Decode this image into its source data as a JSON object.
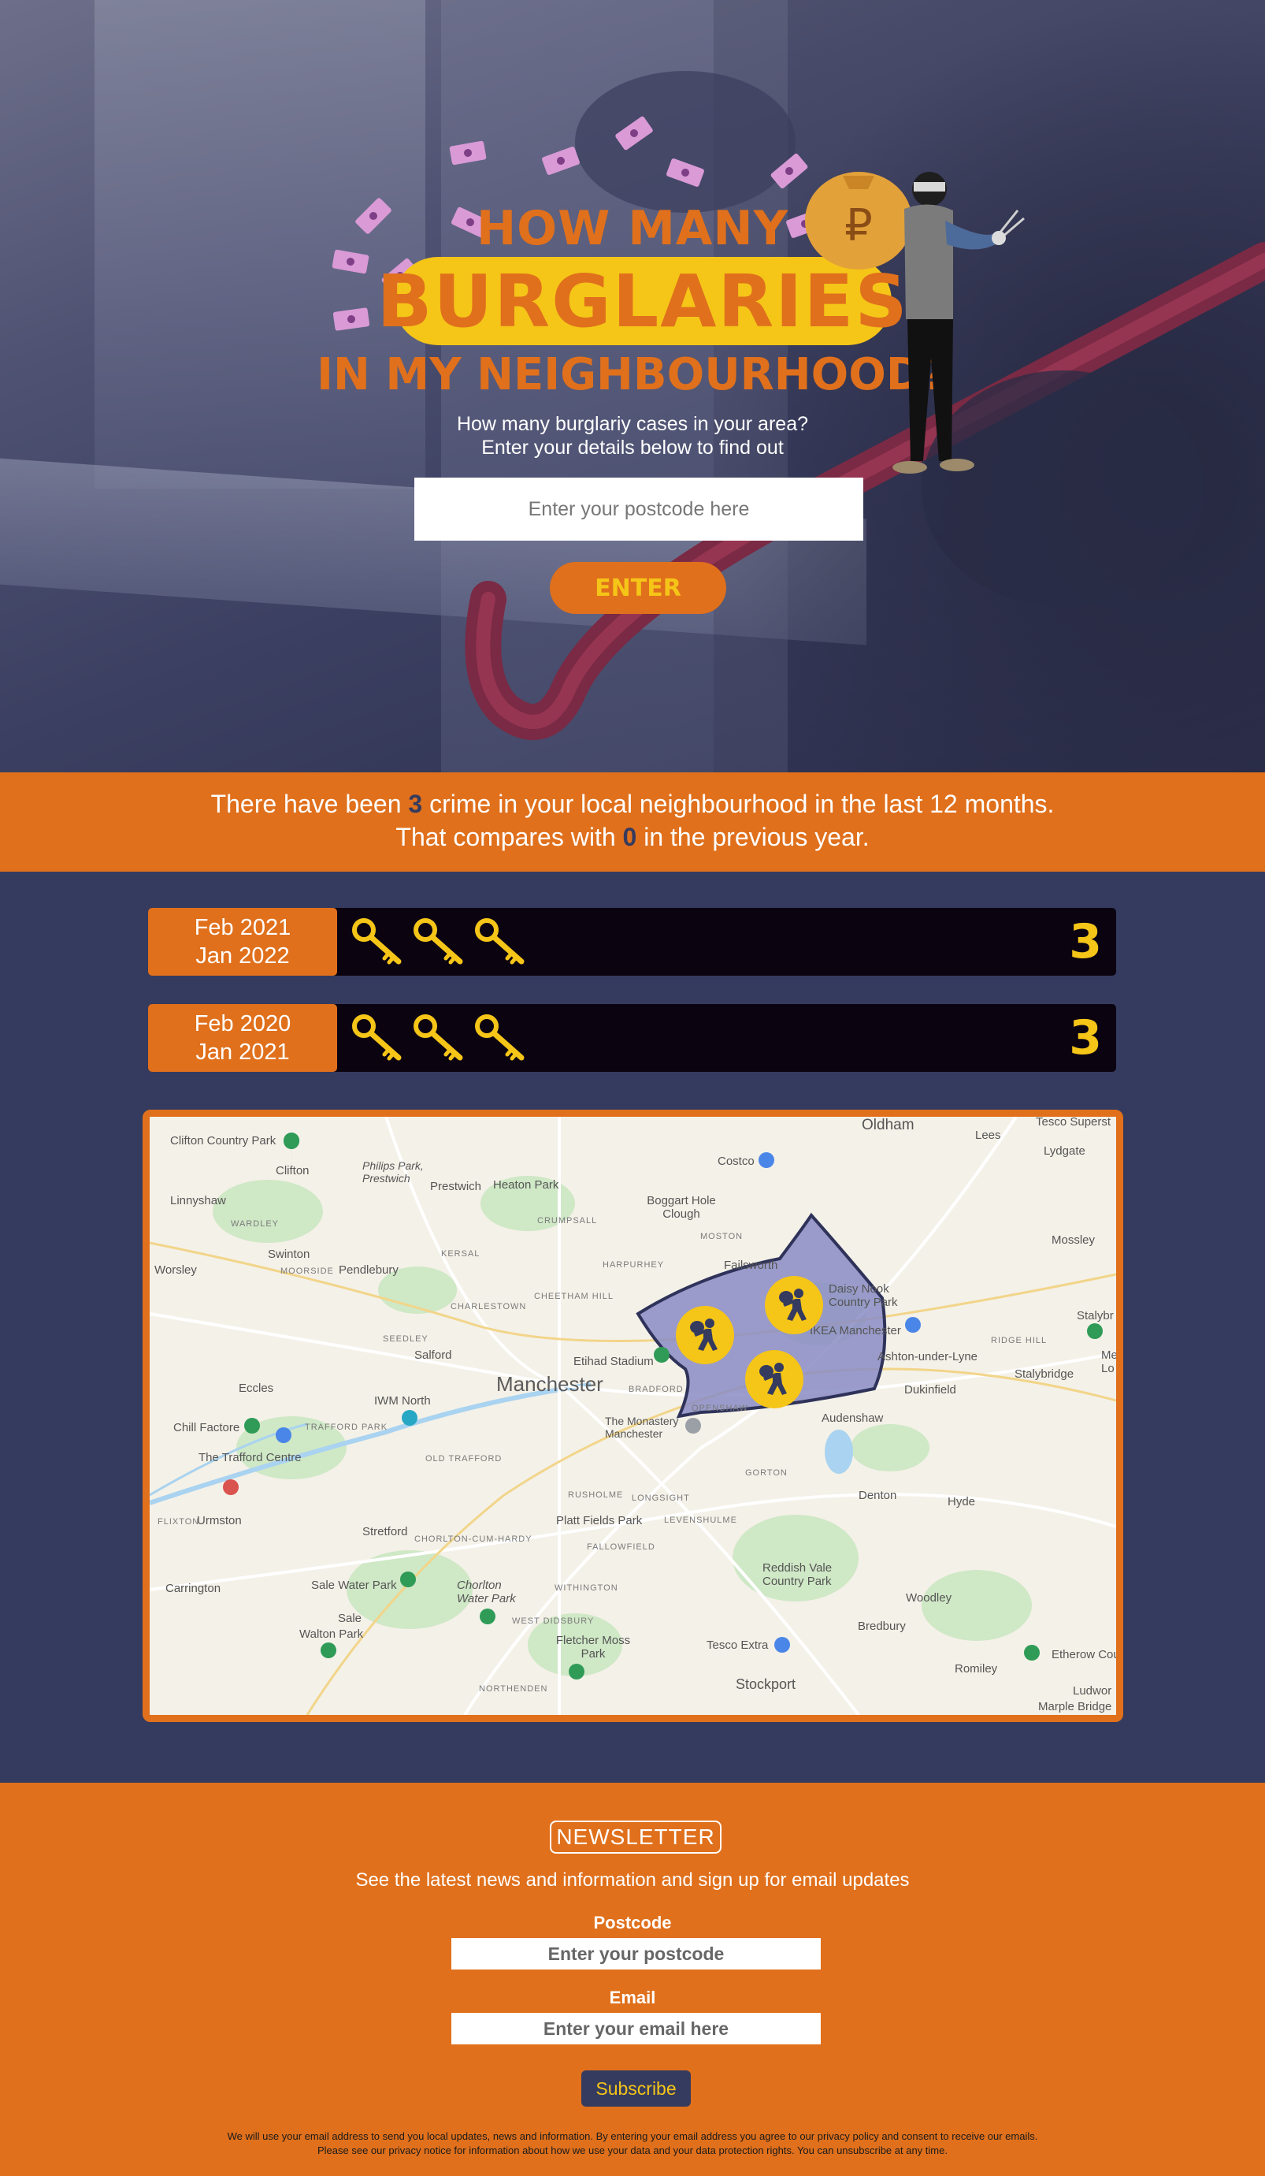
{
  "hero": {
    "title_top": "HOW MANY",
    "title_main": "BURGLARIES",
    "title_bottom": "IN MY NEIGHBOURHOOD?",
    "subtitle_line1": "How many burglariy cases in your area?",
    "subtitle_line2": "Enter your details below to find out",
    "postcode_placeholder": "Enter your postcode here",
    "enter_label": "ENTER"
  },
  "summary": {
    "line1_before": "There have been ",
    "line1_count": "3",
    "line1_after": " crime in your local neighbourhood in the last 12 months.",
    "line2_before": "That compares with ",
    "line2_count": "0",
    "line2_after": " in the previous year."
  },
  "periods": [
    {
      "from": "Feb 2021",
      "to": "Jan 2022",
      "keys": 3,
      "count": "3"
    },
    {
      "from": "Feb 2020",
      "to": "Jan 2021",
      "keys": 3,
      "count": "3"
    }
  ],
  "map": {
    "city": "Manchester",
    "labels": [
      "Oldham",
      "Tesco Superst",
      "Lees",
      "Lydgate",
      "Clifton Country Park",
      "Clifton",
      "Philips Park, Prestwich",
      "Prestwich",
      "Heaton Park",
      "Costco",
      "Linnyshaw",
      "Boggart Hole Clough",
      "WARDLEY",
      "CRUMPSALL",
      "MOSTON",
      "Mossley",
      "Swinton",
      "KERSAL",
      "Worsley",
      "MOORSIDE",
      "Pendlebury",
      "HARPURHEY",
      "Failsworth",
      "Daisy Nook Country Park",
      "Stalybr",
      "CHARLESTOWN",
      "CHEETHAM HILL",
      "IKEA Manchester",
      "RIDGE HILL",
      "SEEDLEY",
      "Salford",
      "Etihad Stadium",
      "Ashton-under-Lyne",
      "Stalybridge",
      "Eccles",
      "IWM North",
      "BRADFORD",
      "Dukinfield",
      "OPENSHAW",
      "Audenshaw",
      "Chill Factore",
      "TRAFFORD PARK",
      "The Monastery Manchester",
      "The Trafford Centre",
      "OLD TRAFFORD",
      "GORTON",
      "RUSHOLME",
      "LONGSIGHT",
      "Denton",
      "Hyde",
      "FLIXTON",
      "Urmston",
      "LEVENSHULME",
      "Platt Fields Park",
      "Stretford",
      "CHORLTON-CUM-HARDY",
      "FALLOWFIELD",
      "Carrington",
      "Sale Water Park",
      "Reddish Vale Country Park",
      "WITHINGTON",
      "Chorlton Water Park",
      "Woodley",
      "Sale",
      "WEST DIDSBURY",
      "Walton Park",
      "Bredbury",
      "Fletcher Moss Park",
      "Tesco Extra",
      "Etherow Cou",
      "Romiley",
      "NORTHENDEN",
      "Stockport",
      "Ludwor",
      "Marple Bridge",
      "Mel Lo"
    ]
  },
  "newsletter": {
    "title": "NEWSLETTER",
    "description": "See the latest news and information and sign up for email updates",
    "postcode_label": "Postcode",
    "postcode_placeholder": "Enter your postcode",
    "email_label": "Email",
    "email_placeholder": "Enter your email here",
    "subscribe_label": "Subscribe",
    "legal_line1": "We will use your email address to send you local updates, news and information. By entering your email address you agree to our privacy policy and consent to receive our emails.",
    "legal_line2": "Please see our privacy notice for information about how we use your data and your data protection rights. You can unsubscribe at any time."
  },
  "colors": {
    "orange": "#e0701c",
    "yellow": "#f5c518",
    "navy": "#353b5e",
    "black_bar": "#0c0311",
    "bill_pink": "#d99ad6",
    "area_purple": "#8a8cc4"
  },
  "icons": [
    "key-icon",
    "burglar-icon",
    "money-bill-icon",
    "money-bag-icon",
    "map-pin-icon"
  ]
}
